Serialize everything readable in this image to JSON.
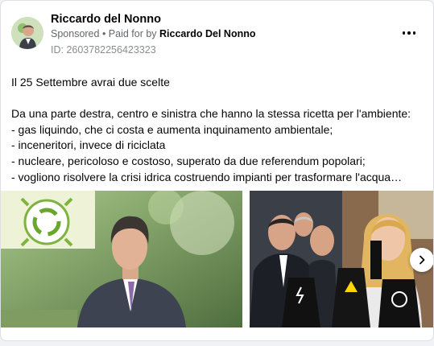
{
  "post": {
    "page_name": "Riccardo del Nonno",
    "sponsored_label": "Sponsored",
    "separator": " • ",
    "paid_for_prefix": "Paid for by ",
    "paid_for_name": "Riccardo Del Nonno",
    "ad_id": "ID: 2603782256423323",
    "body_lines": [
      "Il 25 Settembre avrai due scelte",
      "",
      "Da una parte destra, centro e sinistra che hanno la stessa ricetta per l'ambiente:",
      "- gas liquindo, che ci costa e aumenta inquinamento ambientale;",
      "- inceneritori, invece di riciclata",
      "- nucleare, pericoloso e costoso, superato da due referendum popolari;",
      "- vogliono risolvere la crisi idrica costruendo impianti per trasformare l'acqua…"
    ]
  },
  "icons": {
    "more": "more-options-icon",
    "next": "chevron-right-icon",
    "recycle": "recycle-globe-icon",
    "nuclear": "nuclear-plant-icon"
  },
  "colors": {
    "secondary_text": "#65676b",
    "muted_text": "#8a8d91",
    "card_border": "#dcdfe3"
  }
}
